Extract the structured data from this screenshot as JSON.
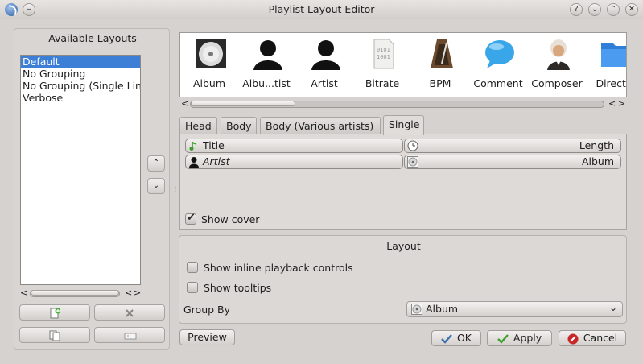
{
  "window": {
    "title": "Playlist Layout Editor"
  },
  "left_panel": {
    "title": "Available Layouts",
    "layouts": [
      "Default",
      "No Grouping",
      "No Grouping (Single Lin",
      "Verbose"
    ],
    "selected_index": 0
  },
  "icon_strip": {
    "items": [
      {
        "label": "Album",
        "icon": "cd-icon"
      },
      {
        "label": "Albu...tist",
        "icon": "person-silhouette-icon"
      },
      {
        "label": "Artist",
        "icon": "person-silhouette-icon"
      },
      {
        "label": "Bitrate",
        "icon": "binary-file-icon"
      },
      {
        "label": "BPM",
        "icon": "metronome-icon"
      },
      {
        "label": "Comment",
        "icon": "speech-bubble-icon"
      },
      {
        "label": "Composer",
        "icon": "composer-portrait-icon"
      },
      {
        "label": "Directo",
        "icon": "folder-icon"
      }
    ]
  },
  "tabs": [
    "Head",
    "Body",
    "Body (Various artists)",
    "Single"
  ],
  "active_tab": "Single",
  "tokens": [
    {
      "label": "Title",
      "icon": "music-note-icon",
      "align": "left",
      "italic": false
    },
    {
      "label": "Length",
      "icon": "clock-icon",
      "align": "right",
      "italic": false
    },
    {
      "label": "Artist",
      "icon": "person-icon",
      "align": "left",
      "italic": true
    },
    {
      "label": "Album",
      "icon": "cd-icon",
      "align": "right",
      "italic": false
    }
  ],
  "show_cover": {
    "label": "Show cover",
    "checked": true
  },
  "layout": {
    "title": "Layout",
    "inline_controls": {
      "label": "Show inline playback controls",
      "checked": false
    },
    "tooltips": {
      "label": "Show tooltips",
      "checked": false
    },
    "group_by": {
      "label": "Group By",
      "value": "Album"
    }
  },
  "buttons": {
    "preview": "Preview",
    "ok": "OK",
    "apply": "Apply",
    "cancel": "Cancel"
  },
  "colors": {
    "selection": "#3d7fd6",
    "background": "#d6d2d0"
  }
}
